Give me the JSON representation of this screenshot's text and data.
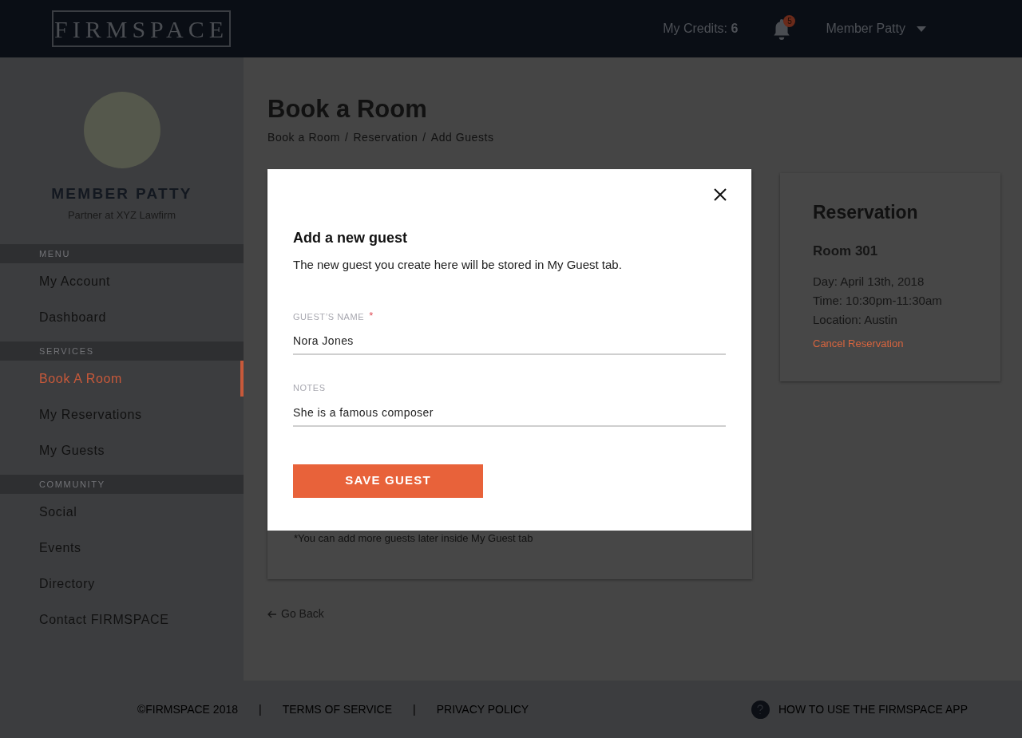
{
  "header": {
    "logo": "FIRMSPACE",
    "credits": "My Credits: **6**",
    "notifications_badge": "5",
    "user_menu": "Member Patty"
  },
  "profile": {
    "name": "MEMBER PATTY",
    "subtitle": "Partner at XYZ Lawfirm"
  },
  "sidebar": {
    "sections": [
      {
        "heading": "MENU",
        "items": [
          {
            "label": "My Account",
            "selected": false
          },
          {
            "label": "Dashboard",
            "selected": false
          }
        ]
      },
      {
        "heading": "SERVICES",
        "items": [
          {
            "label": "Book A Room",
            "selected": true
          },
          {
            "label": "My Reservations",
            "selected": false
          },
          {
            "label": "My Guests",
            "selected": false
          }
        ]
      },
      {
        "heading": "COMMUNITY",
        "items": [
          {
            "label": "Social",
            "selected": false
          },
          {
            "label": "Events",
            "selected": false
          },
          {
            "label": "Directory",
            "selected": false
          },
          {
            "label": "Contact FIRMSPACE",
            "selected": false
          }
        ]
      }
    ]
  },
  "page": {
    "title": "Book a Room",
    "breadcrumb": [
      {
        "kind": "link",
        "text": "Book a Room"
      },
      {
        "kind": "separator",
        "text": "/"
      },
      {
        "kind": "link",
        "text": "Reservation"
      },
      {
        "kind": "separator",
        "text": "/"
      },
      {
        "kind": "link",
        "text": "Add Guests"
      }
    ],
    "note": "*You can add more guests later inside My Guest tab",
    "go_back": "Go Back"
  },
  "reservation": {
    "title": "Reservation",
    "room": "Room 301",
    "lines": [
      "Day: April 13th, 2018",
      "Time: 10:30pm-11:30am",
      "Location: Austin"
    ],
    "cancel": "Cancel Reservation"
  },
  "modal": {
    "title": "Add a new guest",
    "description": "The new guest you create here will be stored in My Guest tab.",
    "fields": [
      {
        "label": "GUEST’S NAME",
        "required_marker": "*",
        "value": "Nora Jones"
      },
      {
        "label": "NOTES",
        "value": "She is a famous composer"
      }
    ],
    "button": "SAVE GUEST"
  },
  "footer": {
    "links": [
      {
        "kind": "text",
        "text": "©FIRMSPACE 2018"
      },
      {
        "kind": "separator",
        "text": "|"
      },
      {
        "kind": "link",
        "text": "TERMS OF SERVICE"
      },
      {
        "kind": "separator",
        "text": "|"
      },
      {
        "kind": "link",
        "text": "PRIVACY POLICY"
      }
    ],
    "help": "HOW TO USE THE FIRMSPACE APP"
  }
}
